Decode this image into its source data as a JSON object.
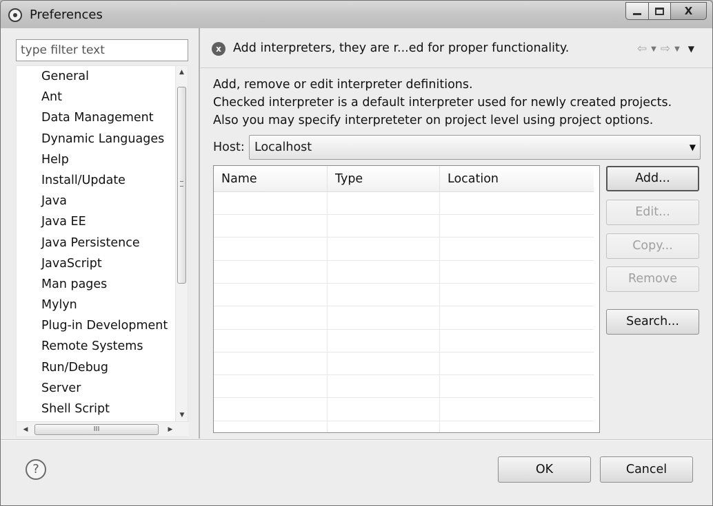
{
  "window": {
    "title": "Preferences",
    "min_icon": "minimize-icon",
    "max_icon": "maximize-icon",
    "close_label": "X"
  },
  "left": {
    "filter_placeholder": "type filter text",
    "tree_items": [
      "General",
      "Ant",
      "Data Management",
      "Dynamic Languages",
      "Help",
      "Install/Update",
      "Java",
      "Java EE",
      "Java Persistence",
      "JavaScript",
      "Man pages",
      "Mylyn",
      "Plug-in Development",
      "Remote Systems",
      "Run/Debug",
      "Server",
      "Shell Script"
    ],
    "hscroll_grip": "III"
  },
  "header": {
    "message": "Add interpreters, they are r...ed for proper functionality.",
    "error_icon_glyph": "x"
  },
  "content": {
    "desc_line1": "Add, remove or edit interpreter definitions.",
    "desc_line2": "Checked interpreter is a default interpreter used for newly created projects.",
    "desc_line3": "Also you may specify interpreteter on project level using project options.",
    "host_label": "Host:",
    "host_value": "Localhost",
    "columns": [
      "Name",
      "Type",
      "Location"
    ],
    "buttons": {
      "add": "Add...",
      "edit": "Edit...",
      "copy": "Copy...",
      "remove": "Remove",
      "search": "Search..."
    }
  },
  "footer": {
    "help_glyph": "?",
    "ok": "OK",
    "cancel": "Cancel"
  }
}
